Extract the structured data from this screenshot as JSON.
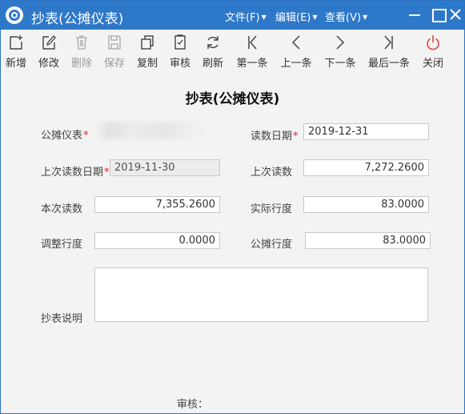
{
  "window": {
    "title": "抄表(公摊仪表)"
  },
  "menu": {
    "file": "文件(F)",
    "edit": "编辑(E)",
    "view": "查看(V)"
  },
  "toolbar": {
    "items": [
      {
        "label": "新增",
        "icon": "add-icon",
        "enabled": true
      },
      {
        "label": "修改",
        "icon": "edit-icon",
        "enabled": true
      },
      {
        "label": "删除",
        "icon": "delete-icon",
        "enabled": false
      },
      {
        "label": "保存",
        "icon": "save-icon",
        "enabled": false
      },
      {
        "label": "复制",
        "icon": "copy-icon",
        "enabled": true
      },
      {
        "label": "审核",
        "icon": "audit-icon",
        "enabled": true
      },
      {
        "label": "刷新",
        "icon": "refresh-icon",
        "enabled": true
      },
      {
        "label": "第一条",
        "icon": "first-icon",
        "enabled": true
      },
      {
        "label": "上一条",
        "icon": "prev-icon",
        "enabled": true
      },
      {
        "label": "下一条",
        "icon": "next-icon",
        "enabled": true
      },
      {
        "label": "最后一条",
        "icon": "last-icon",
        "enabled": true
      },
      {
        "label": "关闭",
        "icon": "power-icon",
        "enabled": true
      }
    ]
  },
  "form": {
    "heading": "抄表(公摊仪表)",
    "required_mark": "*",
    "shared_meter": {
      "label": "公摊仪表",
      "value": ""
    },
    "read_date": {
      "label": "读数日期",
      "value": "2019-12-31"
    },
    "last_read_date": {
      "label": "上次读数日期",
      "value": "2019-11-30"
    },
    "last_reading": {
      "label": "上次读数",
      "value": "7,272.2600"
    },
    "current_reading": {
      "label": "本次读数",
      "value": "7,355.2600"
    },
    "actual_usage": {
      "label": "实际行度",
      "value": "83.0000"
    },
    "adjust_usage": {
      "label": "调整行度",
      "value": "0.0000"
    },
    "shared_usage": {
      "label": "公摊行度",
      "value": "83.0000"
    },
    "remarks": {
      "label": "抄表说明",
      "value": ""
    },
    "auditor": {
      "label": "审核："
    }
  },
  "colors": {
    "titlebar": "#2e78c9",
    "background": "#f3f3f3",
    "required": "#e02020",
    "close_icon": "#e84a3c"
  }
}
